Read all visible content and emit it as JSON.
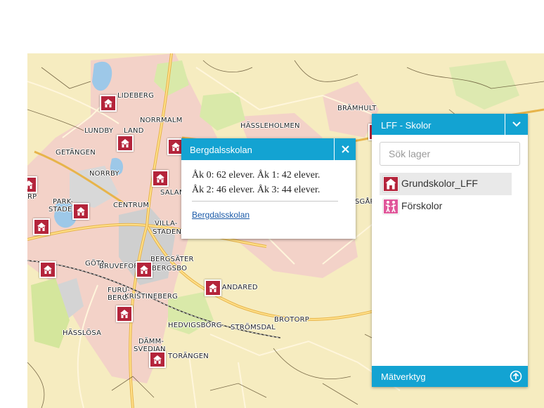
{
  "colors": {
    "accent": "#13a3d2",
    "school_marker": "#b4243b",
    "preschool_marker": "#e0569a",
    "map_background": "#f6ecc0"
  },
  "map": {
    "place_labels": [
      "LIDEBERG",
      "NORRMALM",
      "LUNDBY",
      "LAND",
      "GETÄNGEN",
      "NORRBY",
      "PARK-",
      "STADEN",
      "CENTRUM",
      "VILLA-",
      "STADEN",
      "SALAN",
      "HÄSSLEHOLMEN",
      "BRÄMHULT",
      "GÖTA",
      "BRUVEFOR",
      "BERGSÄTER",
      "BERGSBO",
      "FURU-",
      "BERG",
      "KRISTINEBERG",
      "SANDARED",
      "HEDVIGSBORG",
      "STRÖMSDAL",
      "BROTORP",
      "HÄSSLÖSA",
      "DÄMM-",
      "SVEDJAN",
      "TORÄNGEN",
      "SGÅR",
      "RP"
    ],
    "school_icon": "school-building-icon"
  },
  "popup": {
    "title": "Bergdalsskolan",
    "close_icon": "close-icon",
    "line1": "Åk 0: 62 elever. Åk 1: 42 elever.",
    "line2": "Åk 2: 46 elever. Åk 3: 44 elever.",
    "link": "Bergdalsskolan"
  },
  "layer_panel": {
    "title": "LFF - Skolor",
    "toggle_icon": "chevron-down-icon",
    "search_placeholder": "Sök lager",
    "layers": [
      {
        "label": "Grundskolor_LFF",
        "icon": "school-building-icon",
        "active": true
      },
      {
        "label": "Förskolor",
        "icon": "preschool-children-icon",
        "active": false
      }
    ],
    "footer_label": "Mätverktyg",
    "footer_icon": "arrow-up-circle-icon"
  }
}
